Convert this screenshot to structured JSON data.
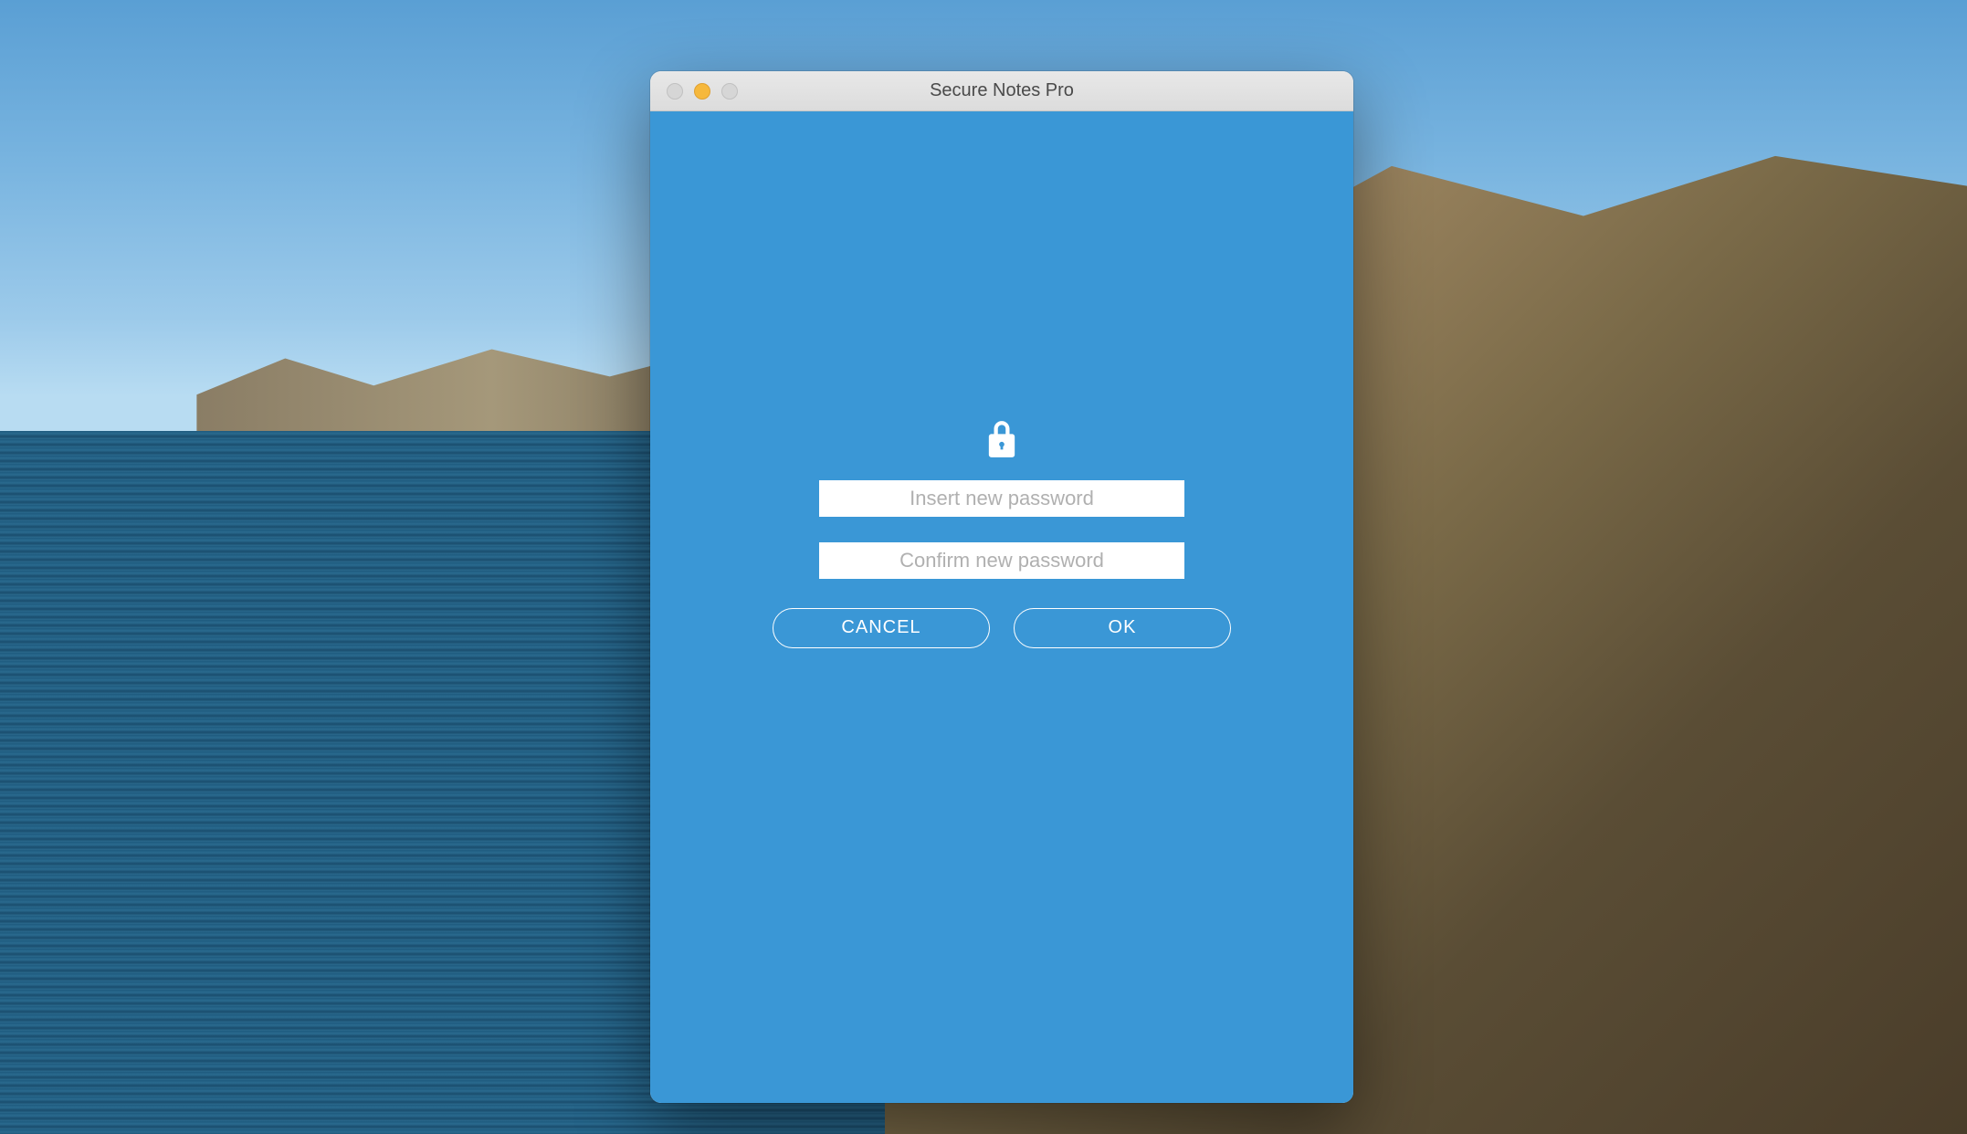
{
  "window": {
    "title": "Secure Notes Pro"
  },
  "dialog": {
    "password_placeholder": "Insert new password",
    "confirm_placeholder": "Confirm new password",
    "cancel_label": "CANCEL",
    "ok_label": "OK"
  },
  "colors": {
    "app_background": "#3a97d6",
    "titlebar": "#e0e0e0"
  }
}
